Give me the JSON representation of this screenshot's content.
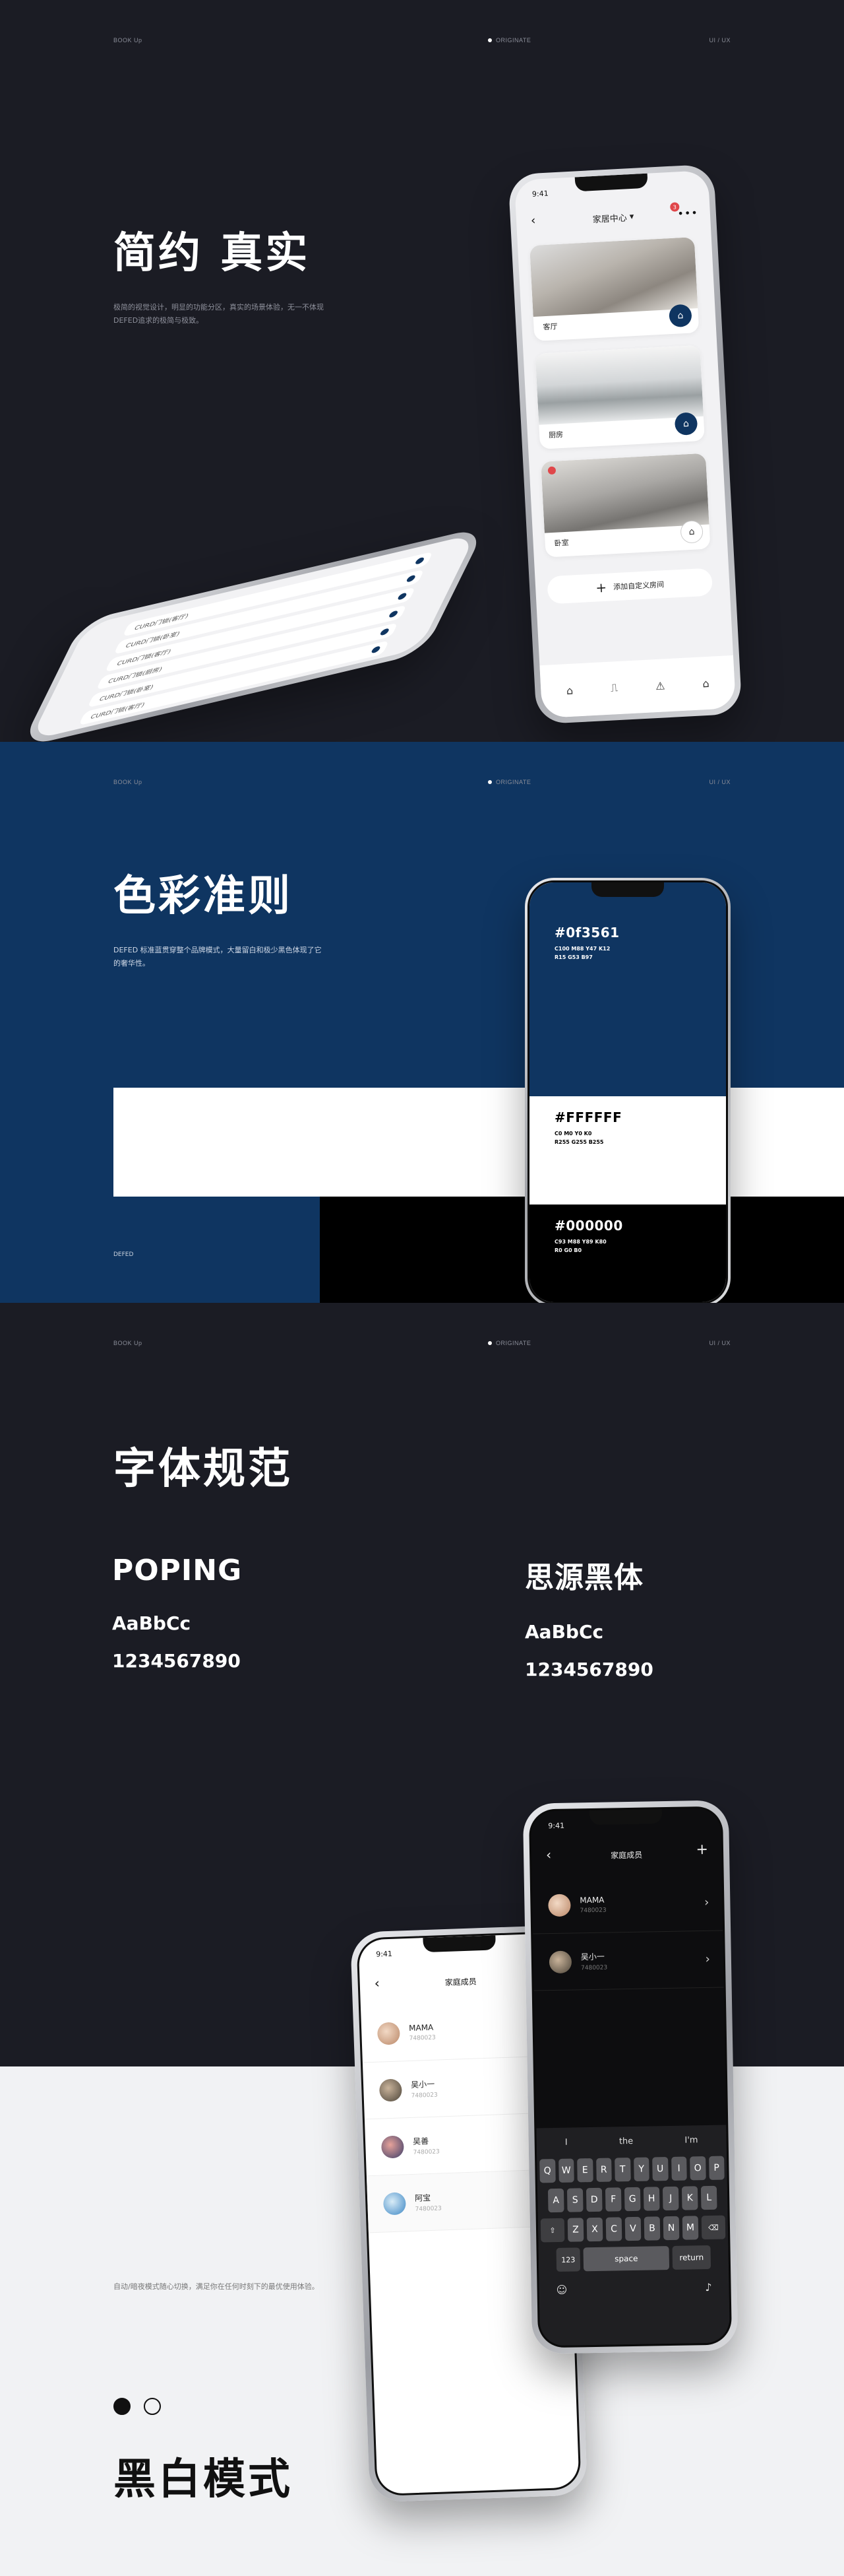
{
  "meta": {
    "left": "BOOK Up",
    "center": "ORIGINATE",
    "right": "UI / UX"
  },
  "s1": {
    "title": "简约 真实",
    "desc": "极简的视觉设计，明显的功能分区，真实的场景体验，无一不体现DEFED追求的极简与极致。",
    "phone_time": "9:41",
    "phone_title": "家居中心",
    "badge": "3",
    "rooms": [
      "客厅",
      "厨房",
      "卧室"
    ],
    "add_label": "添加自定义房间",
    "lying_rows": [
      "CURD门锁(客厅)",
      "CURD门锁(卧室)",
      "CURD门锁(客厅)",
      "CURD门锁(厨房)",
      "CURD门锁(卧室)",
      "CURD门锁(客厅)"
    ]
  },
  "s2": {
    "title": "色彩准则",
    "desc": "DEFED 标准蓝贯穿整个品牌模式，大量留白和极少黑色体现了它的奢华性。",
    "footer": "DEFED",
    "colors": [
      {
        "hex": "#0f3561",
        "line1": "C100 M88 Y47 K12",
        "line2": "R15 G53 B97",
        "swatch": "#0f3561"
      },
      {
        "hex": "#FFFFFF",
        "line1": "C0 M0 Y0 K0",
        "line2": "R255 G255 B255",
        "swatch": "#ffffff"
      },
      {
        "hex": "#000000",
        "line1": "C93 M88 Y89 K80",
        "line2": "R0 G0 B0",
        "swatch": "#000000"
      }
    ]
  },
  "s3": {
    "title": "字体规范",
    "fonts": [
      {
        "name": "POPING",
        "sample": "AaBbCc",
        "digits": "1234567890"
      },
      {
        "name": "思源黑体",
        "sample": "AaBbCc",
        "digits": "1234567890"
      }
    ]
  },
  "s4": {
    "title": "黑白模式",
    "desc": "自动/暗夜模式随心切换，满足你在任何时刻下的最优使用体验。",
    "phone_time": "9:41",
    "phone_title": "家庭成员",
    "members": [
      {
        "name": "MAMA",
        "phone": "7480023"
      },
      {
        "name": "吴小一",
        "phone": "7480023"
      },
      {
        "name": "吴善",
        "phone": "7480023"
      },
      {
        "name": "阿宝",
        "phone": "7480023"
      }
    ],
    "dark_members": [
      {
        "name": "MAMA",
        "phone": "7480023"
      },
      {
        "name": "吴小一",
        "phone": "7480023"
      }
    ],
    "suggestions": [
      "I",
      "the",
      "I'm"
    ],
    "keys_row1": [
      "Q",
      "W",
      "E",
      "R",
      "T",
      "Y",
      "U",
      "I",
      "O",
      "P"
    ],
    "keys_row2": [
      "A",
      "S",
      "D",
      "F",
      "G",
      "H",
      "J",
      "K",
      "L"
    ],
    "keys_row3": [
      "Z",
      "X",
      "C",
      "V",
      "B",
      "N",
      "M"
    ],
    "key_123": "123",
    "key_space": "space",
    "key_return": "return"
  }
}
